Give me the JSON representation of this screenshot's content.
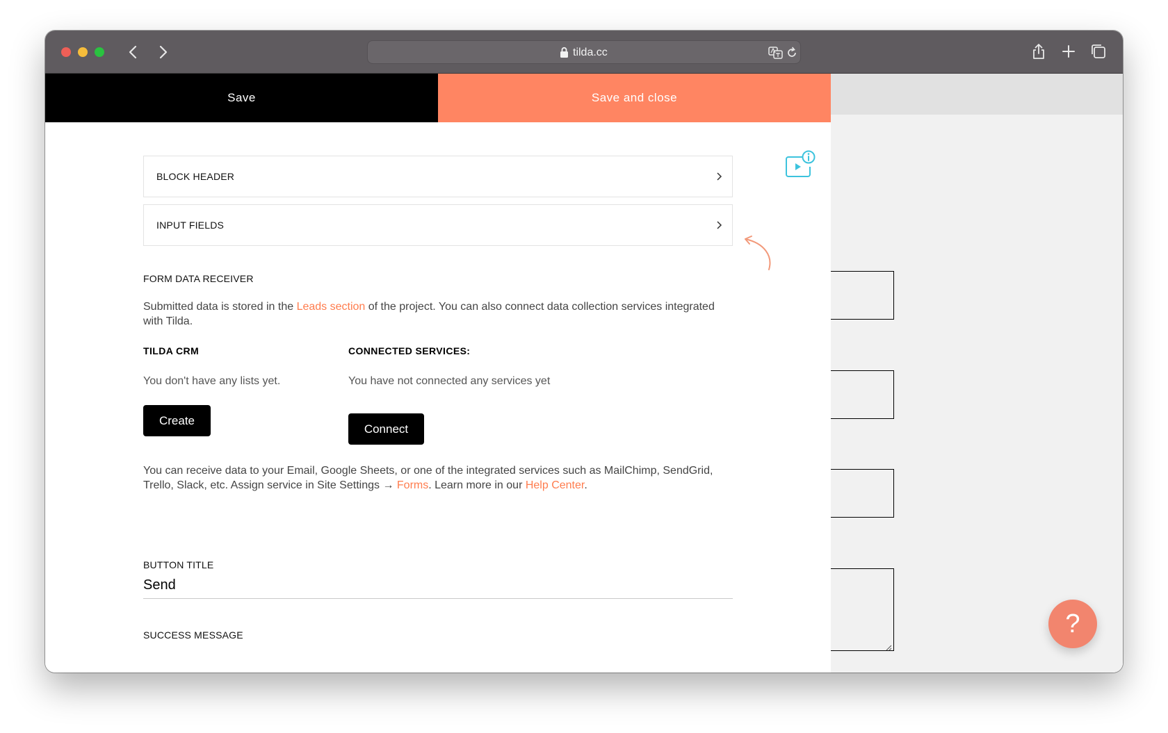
{
  "browser": {
    "url": "tilda.cc"
  },
  "toolbar": {
    "save_label": "Save",
    "save_close_label": "Save and close"
  },
  "settings": {
    "accordion": [
      {
        "label": "BLOCK HEADER"
      },
      {
        "label": "INPUT FIELDS"
      }
    ],
    "form_data_receiver": {
      "label": "FORM DATA RECEIVER",
      "description_before": "Submitted data is stored in the ",
      "description_link": "Leads section",
      "description_after": " of the project. You can also connect data collection services integrated with Tilda."
    },
    "tilda_crm": {
      "label": "TILDA CRM",
      "empty_text": "You don't have any lists yet.",
      "button_label": "Create"
    },
    "connected_services": {
      "label": "CONNECTED SERVICES:",
      "empty_text": "You have not connected any services yet",
      "button_label": "Connect"
    },
    "info": {
      "text_1": "You can receive data to your Email, Google Sheets, or one of the integrated services such as MailChimp, SendGrid, Trello, Slack, etc. Assign service in Site Settings → ",
      "link_forms": "Forms",
      "text_2": ". Learn more in our ",
      "link_help": "Help Center",
      "text_3": "."
    },
    "button_title": {
      "label": "BUTTON TITLE",
      "value": "Send"
    },
    "success_message": {
      "label": "SUCCESS MESSAGE"
    }
  },
  "help": {
    "icon_glyph": "?"
  },
  "colors": {
    "accent": "#ff8562",
    "link": "#ff7c4d",
    "help_button": "#f2856e",
    "video_icon": "#3cc3dd"
  }
}
